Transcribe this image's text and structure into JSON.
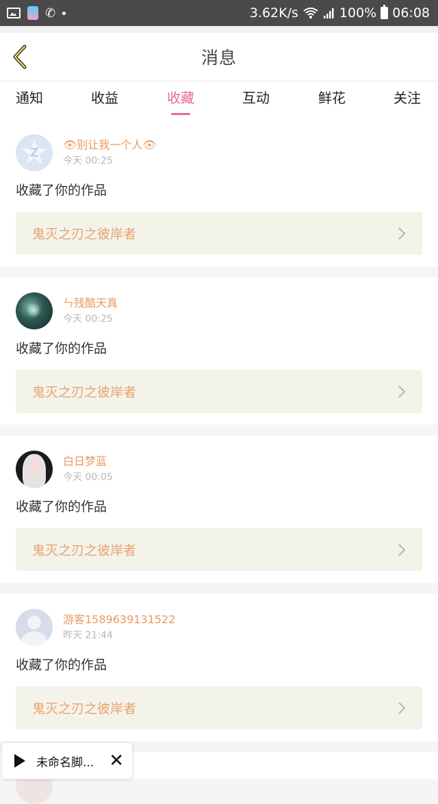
{
  "status_bar": {
    "speed": "3.62K/s",
    "battery": "100%",
    "time": "06:08",
    "icons": [
      "image-icon",
      "app-icon",
      "phone-wifi-icon",
      "dot-icon",
      "wifi-icon",
      "signal-icon",
      "battery-icon"
    ]
  },
  "header": {
    "title": "消息",
    "back_icon": "chevron-left-icon"
  },
  "tabs": [
    {
      "label": "通知",
      "active": false
    },
    {
      "label": "收益",
      "active": false
    },
    {
      "label": "收藏",
      "active": true
    },
    {
      "label": "互动",
      "active": false
    },
    {
      "label": "鲜花",
      "active": false
    },
    {
      "label": "关注",
      "active": false
    }
  ],
  "colors": {
    "accent": "#e8679e",
    "username": "#e79a63",
    "work_title": "#e9a26c",
    "work_bg": "#f4f3ea"
  },
  "notifications": [
    {
      "username": "👁别让我一个人👁",
      "time": "今天 00:25",
      "action": "收藏了你的作品",
      "work": "鬼灭之刃之彼岸者",
      "avatar": "qq-default-avatar"
    },
    {
      "username": "ㄣ残酷天真",
      "time": "今天 00:25",
      "action": "收藏了你的作品",
      "work": "鬼灭之刃之彼岸者",
      "avatar": "forest-avatar"
    },
    {
      "username": "白日梦蓝",
      "time": "今天 00:05",
      "action": "收藏了你的作品",
      "work": "鬼灭之刃之彼岸者",
      "avatar": "girl-avatar"
    },
    {
      "username": "游客1589639131522",
      "time": "昨天 21:44",
      "action": "收藏了你的作品",
      "work": "鬼灭之刃之彼岸者",
      "avatar": "guest-avatar"
    }
  ],
  "floating_widget": {
    "label": "未命名脚...",
    "play_icon": "play-icon",
    "close_icon": "close-icon"
  }
}
